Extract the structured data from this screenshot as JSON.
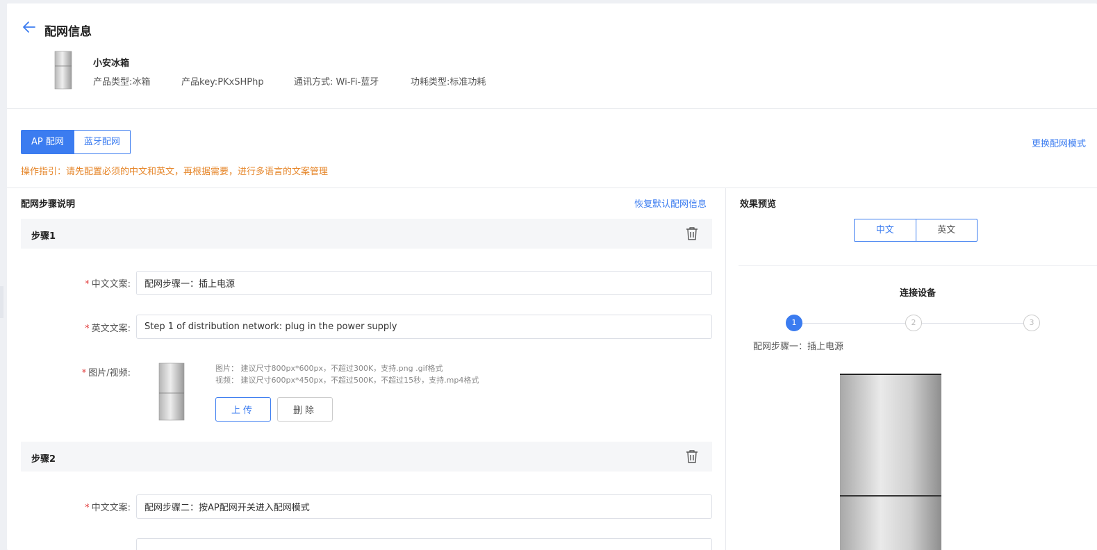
{
  "header": {
    "title": "配网信息"
  },
  "product": {
    "name": "小安冰箱",
    "type": "产品类型:冰箱",
    "key": "产品key:PKxSHPhp",
    "comm": "通讯方式: Wi-Fi-蓝牙",
    "power": "功耗类型:标准功耗"
  },
  "mode_tabs": {
    "ap": "AP 配网",
    "bluetooth": "蓝牙配网",
    "active": "ap"
  },
  "switch_mode_label": "更换配网模式",
  "hint": "操作指引：请先配置必须的中文和英文，再根据需要，进行多语言的文案管理",
  "steps_section": {
    "title": "配网步骤说明",
    "restore_label": "恢复默认配网信息"
  },
  "steps": [
    {
      "title": "步骤1",
      "cn_label": "中文文案:",
      "cn_value": "配网步骤一：插上电源",
      "en_label": "英文文案:",
      "en_value": "Step 1 of distribution network: plug in the power supply",
      "media_label": "图片/视频:",
      "media_tip_image": "图片：  建议尺寸800px*600px，不超过300K，支持.png .gif格式",
      "media_tip_video": "视频：  建议尺寸600px*450px，不超过500K，不超过15秒，支持.mp4格式",
      "upload_label": "上传",
      "delete_label": "删除"
    },
    {
      "title": "步骤2",
      "cn_label": "中文文案:",
      "cn_value": "配网步骤二：按AP配网开关进入配网模式"
    }
  ],
  "preview": {
    "title": "效果预览",
    "lang_tabs": [
      "中文",
      "英文"
    ],
    "active_lang": "中文",
    "screen_title": "连接设备",
    "stepper": [
      "1",
      "2",
      "3"
    ],
    "current_step": 1,
    "step_text": "配网步骤一：插上电源"
  },
  "colors": {
    "accent": "#3b7cf0",
    "hint": "#e6862a",
    "required": "#e23c3c"
  },
  "icons": {
    "back": "arrow-left-icon",
    "trash": "trash-icon"
  }
}
